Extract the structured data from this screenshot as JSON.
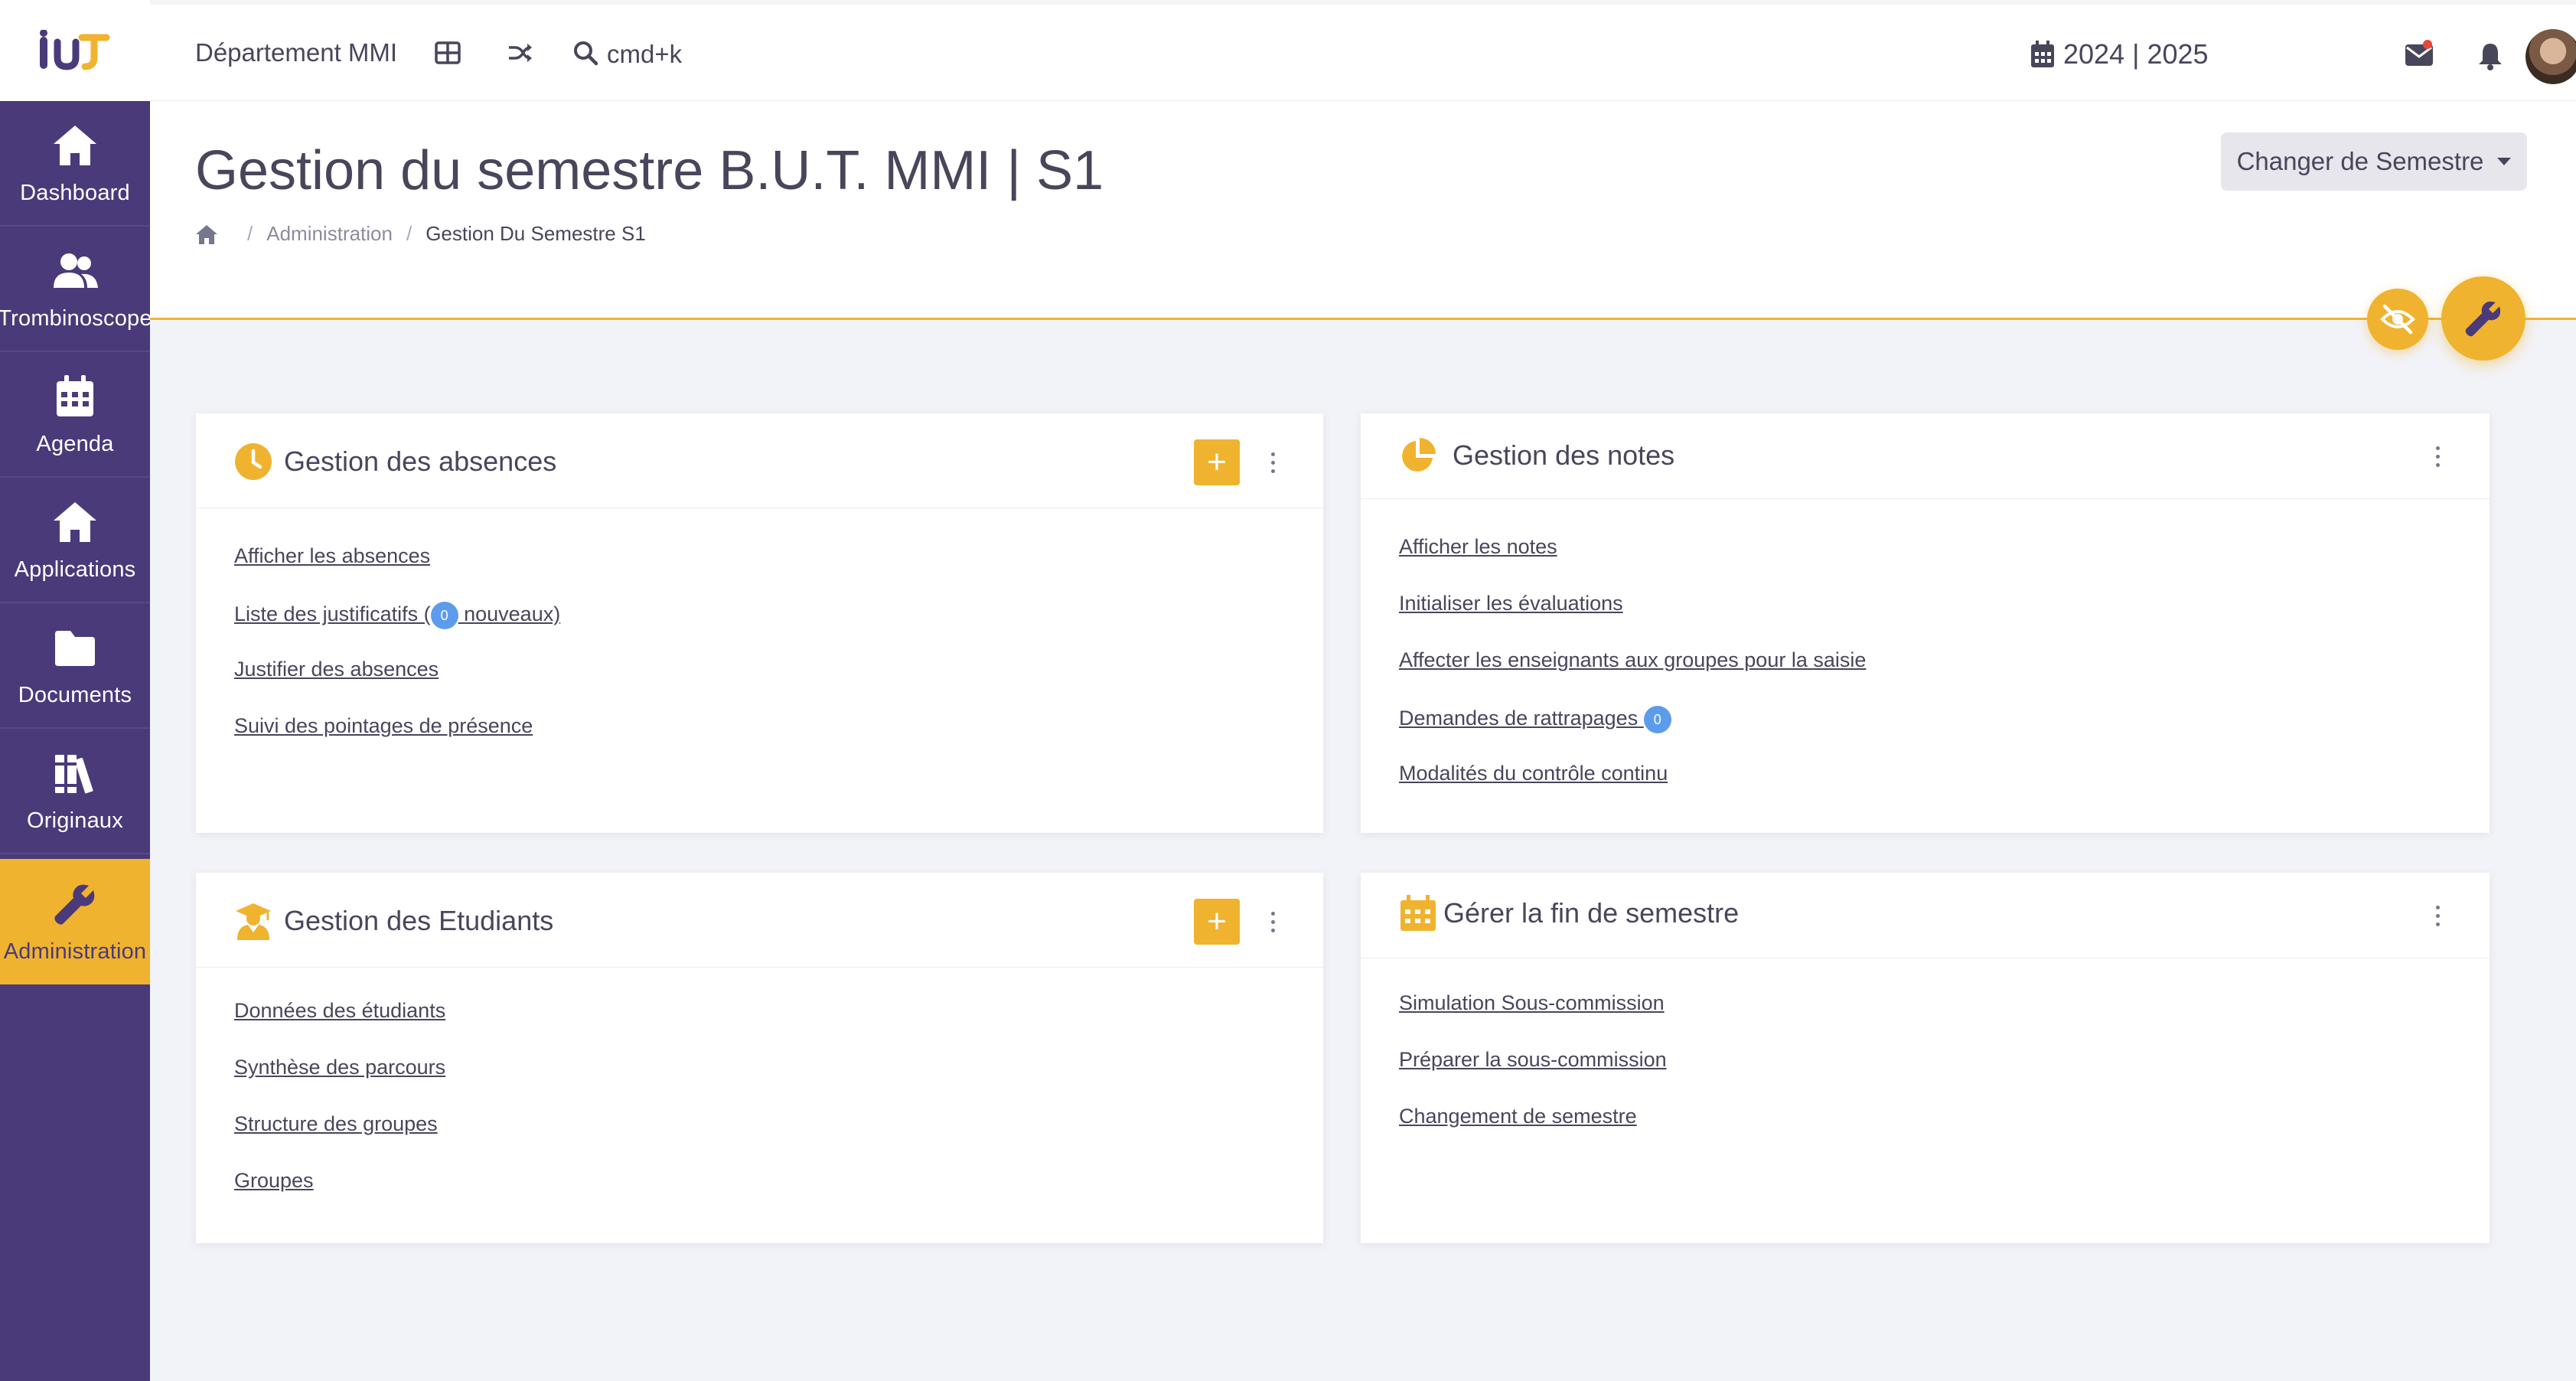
{
  "app": {
    "logo_text": "IUT",
    "department": "Département MMI",
    "search_shortcut": "cmd+k",
    "academic_year": "2024 | 2025"
  },
  "colors": {
    "sidebar": "#4a3a7a",
    "accent": "#f0b32f",
    "badge": "#5d9cec"
  },
  "sidebar": {
    "items": [
      {
        "label": "Dashboard",
        "icon": "home-icon"
      },
      {
        "label": "Trombinoscope",
        "icon": "users-icon"
      },
      {
        "label": "Agenda",
        "icon": "calendar-icon"
      },
      {
        "label": "Applications",
        "icon": "home-icon"
      },
      {
        "label": "Documents",
        "icon": "folder-icon"
      },
      {
        "label": "Originaux",
        "icon": "books-icon"
      },
      {
        "label": "Administration",
        "icon": "wrench-icon",
        "active": true
      }
    ]
  },
  "page": {
    "title": "Gestion du semestre B.U.T. MMI | S1",
    "breadcrumb": [
      "Administration",
      "Gestion Du Semestre S1"
    ],
    "change_semester_label": "Changer de Semestre"
  },
  "cards": {
    "absences": {
      "title": "Gestion des absences",
      "links": [
        "Afficher les absences",
        "Liste des justificatifs (",
        "nouveaux)",
        "Justifier des absences",
        "Suivi des pointages de présence"
      ],
      "badge": "0"
    },
    "notes": {
      "title": "Gestion des notes",
      "links": [
        "Afficher les notes",
        "Initialiser les évaluations",
        "Affecter les enseignants aux groupes pour la saisie",
        "Demandes de rattrapages",
        "Modalités du contrôle continu"
      ],
      "badge": "0"
    },
    "etudiants": {
      "title": "Gestion des Etudiants",
      "links": [
        "Données des étudiants",
        "Synthèse des parcours",
        "Structure des groupes",
        "Groupes"
      ]
    },
    "fin_semestre": {
      "title": "Gérer la fin de semestre",
      "links": [
        "Simulation Sous-commission",
        "Préparer la sous-commission",
        "Changement de semestre"
      ]
    }
  }
}
